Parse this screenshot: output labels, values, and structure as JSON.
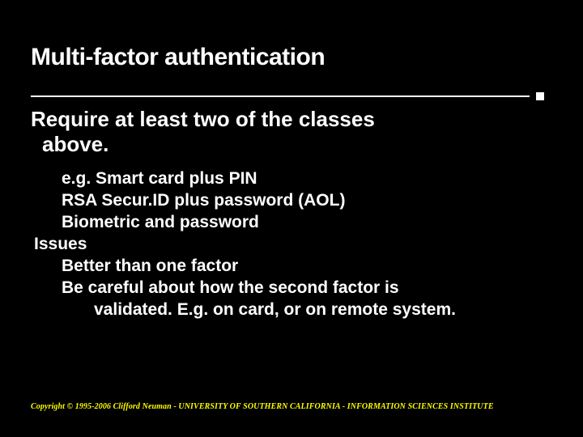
{
  "title": "Multi-factor authentication",
  "body": {
    "heading_l1": "Require at least two of the classes",
    "heading_l2": "above.",
    "lines": {
      "eg1": "e.g. Smart card plus PIN",
      "eg2": "RSA Secur.ID plus password (AOL)",
      "eg3": "Biometric and password",
      "issues": "Issues",
      "b1": "Better than one factor",
      "b2a": "Be careful about how the second factor is",
      "b2b": "validated.   E.g. on card, or on remote system."
    }
  },
  "footer": "Copyright © 1995-2006 Clifford Neuman - UNIVERSITY OF SOUTHERN CALIFORNIA - INFORMATION SCIENCES INSTITUTE"
}
